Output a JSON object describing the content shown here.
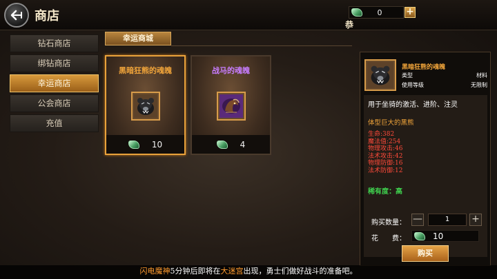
{
  "header": {
    "title": "商店",
    "currency_value": "0",
    "plus_label": "+",
    "glyph_below_currency": "恭"
  },
  "sidebar": {
    "items": [
      {
        "label": "钻石商店",
        "active": false
      },
      {
        "label": "绑钻商店",
        "active": false
      },
      {
        "label": "幸运商店",
        "active": true
      },
      {
        "label": "公会商店",
        "active": false
      },
      {
        "label": "充值",
        "active": false
      }
    ]
  },
  "section": {
    "tab_label": "幸运商城"
  },
  "cards": [
    {
      "name": "黑暗狂熊的魂魄",
      "name_color": "#f0a43a",
      "price": "10",
      "selected": true
    },
    {
      "name": "战马的魂魄",
      "name_color": "#c77dff",
      "price": "4",
      "selected": false
    }
  ],
  "detail": {
    "name": "黑暗狂熊的魂魄",
    "type_label": "类型",
    "type_value": "材料",
    "level_label": "使用等级",
    "level_value": "无限制",
    "description": "用于坐骑的激活、进阶、注灵",
    "subtitle": "体型巨大的黑熊",
    "stats": [
      "生命:382",
      "魔法值:254",
      "物理攻击:46",
      "法术攻击:42",
      "物理防御:16",
      "法术防御:12"
    ],
    "rarity": "稀有度：高",
    "quantity_label": "购买数量：",
    "quantity_value": "1",
    "minus_label": "—",
    "plus_label": "+",
    "cost_label": "花　　费：",
    "cost_value": "10",
    "buy_label": "购买"
  },
  "ticker": {
    "part1": "闪电魔神",
    "part2": "5分钟后即将在",
    "part3": "大迷宫",
    "part4": "出现，勇士们做好战斗的准备吧。"
  },
  "colors": {
    "accent_orange": "#e9a23b",
    "rarity_green": "#3fcf4e",
    "stat_red": "#ff4a3a",
    "currency_icon": "jade-icon"
  }
}
